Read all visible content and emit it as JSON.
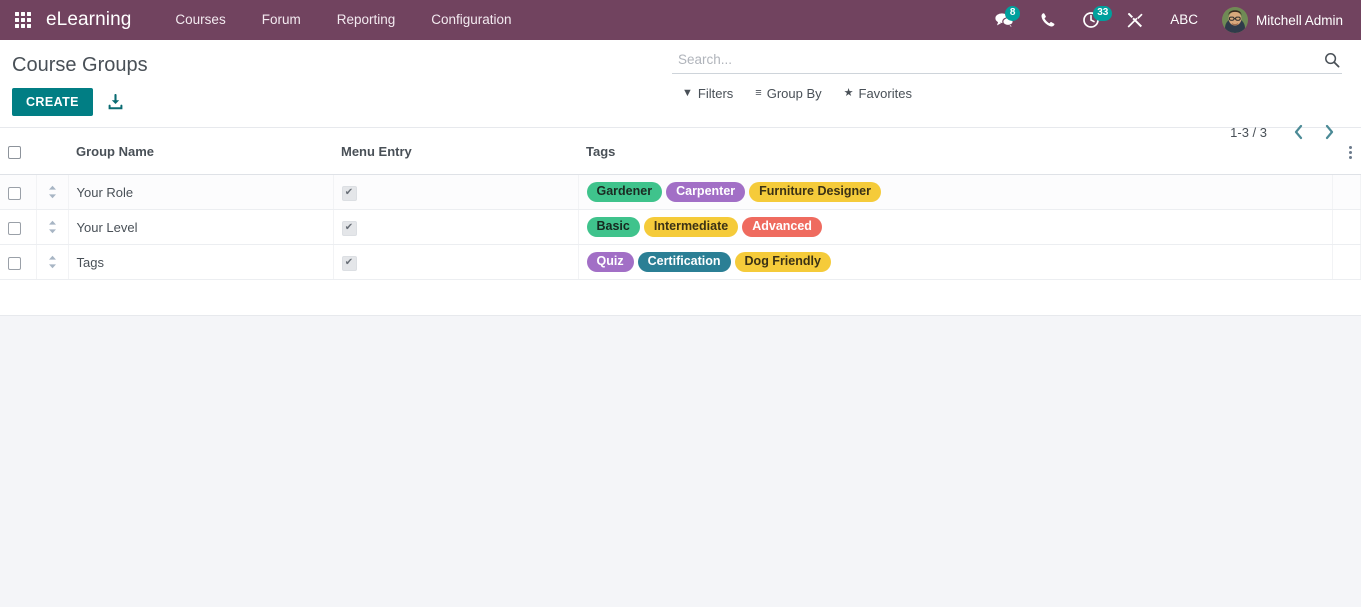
{
  "navbar": {
    "apps_icon": "apps-grid-icon",
    "brand": "eLearning",
    "menus": [
      {
        "label": "Courses"
      },
      {
        "label": "Forum"
      },
      {
        "label": "Reporting"
      },
      {
        "label": "Configuration"
      }
    ],
    "systray": {
      "messages_icon": "messages-icon",
      "messages_count": "8",
      "phone_icon": "phone-icon",
      "activities_icon": "activities-clock-icon",
      "activities_count": "33",
      "tools_icon": "wrench-tools-icon",
      "debug_label": "ABC",
      "avatar_icon": "user-avatar",
      "username": "Mitchell Admin"
    },
    "bg_color": "#71435f"
  },
  "control_panel": {
    "title": "Course Groups",
    "create_label": "CREATE",
    "import_icon": "import-download-icon",
    "search": {
      "placeholder": "Search...",
      "value": "",
      "icon": "search-icon"
    },
    "filters": [
      {
        "label": "Filters",
        "icon": "filter-funnel-icon",
        "glyph": "▼"
      },
      {
        "label": "Group By",
        "icon": "group-by-lines-icon",
        "glyph": "≡"
      },
      {
        "label": "Favorites",
        "icon": "favorites-star-icon",
        "glyph": "★"
      }
    ],
    "pager": {
      "count": "1-3 / 3",
      "prev_icon": "chevron-left-icon",
      "next_icon": "chevron-right-icon"
    }
  },
  "list": {
    "columns": {
      "select_all": "",
      "group_name": "Group Name",
      "menu_entry": "Menu Entry",
      "tags": "Tags"
    },
    "optional_columns_icon": "vertical-dots-icon",
    "rows": [
      {
        "name": "Your Role",
        "menu_entry": true,
        "menu_entry_glyph": "✔",
        "tags": [
          {
            "label": "Gardener",
            "bg": "#3fc38c",
            "fg": "#1b2a22"
          },
          {
            "label": "Carpenter",
            "bg": "#a26fc6",
            "fg": "#ffffff"
          },
          {
            "label": "Furniture Designer",
            "bg": "#f5cb3a",
            "fg": "#3a3115"
          }
        ]
      },
      {
        "name": "Your Level",
        "menu_entry": true,
        "menu_entry_glyph": "✔",
        "tags": [
          {
            "label": "Basic",
            "bg": "#3fc38c",
            "fg": "#16291f"
          },
          {
            "label": "Intermediate",
            "bg": "#f5cb3a",
            "fg": "#3a3115"
          },
          {
            "label": "Advanced",
            "bg": "#ef6b5f",
            "fg": "#ffffff"
          }
        ]
      },
      {
        "name": "Tags",
        "menu_entry": true,
        "menu_entry_glyph": "✔",
        "tags": [
          {
            "label": "Quiz",
            "bg": "#a26fc6",
            "fg": "#ffffff"
          },
          {
            "label": "Certification",
            "bg": "#2b7f95",
            "fg": "#ffffff"
          },
          {
            "label": "Dog Friendly",
            "bg": "#f5cb3a",
            "fg": "#3a3115"
          }
        ]
      }
    ]
  },
  "colors": {
    "brand_purple": "#71435f",
    "accent_teal": "#017e84",
    "page_bg": "#f4f5f8"
  }
}
